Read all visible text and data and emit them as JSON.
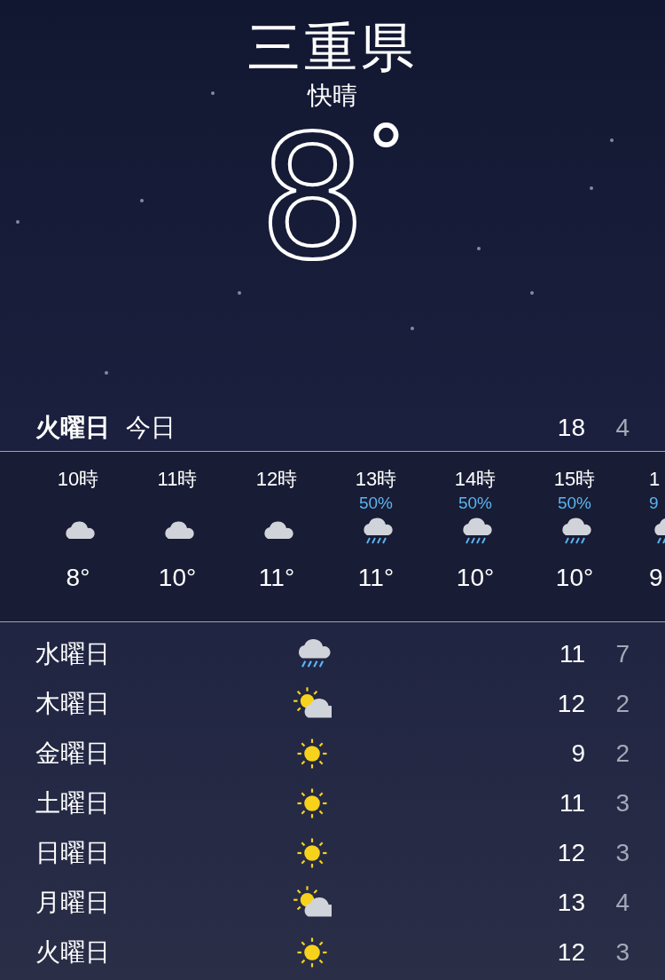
{
  "location": "三重県",
  "condition": "快晴",
  "temperature": "8",
  "degree": "°",
  "today": {
    "day": "火曜日",
    "label": "今日",
    "high": "18",
    "low": "4"
  },
  "hourly": [
    {
      "time": "10時",
      "kind": "cloud",
      "temp": "8°"
    },
    {
      "time": "11時",
      "kind": "cloud",
      "temp": "10°"
    },
    {
      "time": "12時",
      "kind": "cloud",
      "temp": "11°"
    },
    {
      "time": "13時",
      "kind": "rain",
      "precip": "50%",
      "temp": "11°"
    },
    {
      "time": "14時",
      "kind": "rain",
      "precip": "50%",
      "temp": "10°"
    },
    {
      "time": "15時",
      "kind": "rain",
      "precip": "50%",
      "temp": "10°"
    }
  ],
  "cut_hour": {
    "time": "1",
    "kind": "rain",
    "precip": "9",
    "temp": "9"
  },
  "daily": [
    {
      "day": "水曜日",
      "kind": "rain",
      "high": "11",
      "low": "7"
    },
    {
      "day": "木曜日",
      "kind": "partly_sunny",
      "high": "12",
      "low": "2"
    },
    {
      "day": "金曜日",
      "kind": "sunny",
      "high": "9",
      "low": "2"
    },
    {
      "day": "土曜日",
      "kind": "sunny",
      "high": "11",
      "low": "3"
    },
    {
      "day": "日曜日",
      "kind": "sunny",
      "high": "12",
      "low": "3"
    },
    {
      "day": "月曜日",
      "kind": "partly_sunny",
      "high": "13",
      "low": "4"
    },
    {
      "day": "火曜日",
      "kind": "sunny",
      "high": "12",
      "low": "3"
    }
  ]
}
